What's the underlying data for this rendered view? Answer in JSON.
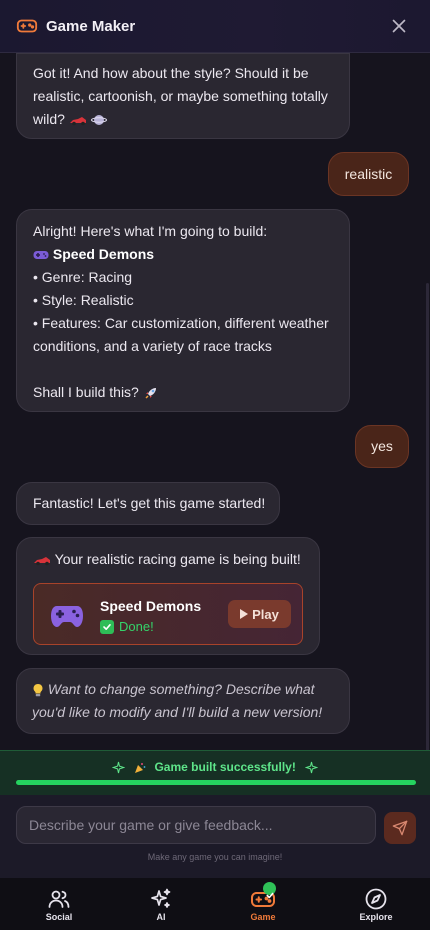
{
  "header": {
    "title": "Game Maker",
    "icon": "gamepad-icon",
    "close_icon": "close-icon"
  },
  "messages": {
    "m1": {
      "line1": "Got it! And how about the style? Should it be",
      "line2": "realistic, cartoonish, or maybe something totally",
      "line3": "wild? "
    },
    "m2": "realistic",
    "m3": {
      "intro": "Alright! Here's what I'm going to build:",
      "game_name": "Speed Demons",
      "genre": "• Genre: Racing",
      "style": "• Style: Realistic",
      "features_line1": "• Features: Car customization, different weather",
      "features_line2": "conditions, and a variety of race tracks",
      "question": "Shall I build this? "
    },
    "m4": "yes",
    "m5": "Fantastic! Let's get this game started!",
    "m6": {
      "text": "Your realistic racing game is being built!",
      "card_title": "Speed Demons",
      "card_status": "Done!",
      "play_label": "Play"
    },
    "m7": {
      "line1": "Want to change something? Describe what",
      "line2": "you'd like to modify and I'll build a new version!"
    }
  },
  "success": {
    "text": "Game built successfully!",
    "progress": 1.0
  },
  "input": {
    "placeholder": "Describe your game or give feedback...",
    "hint": "Make any game you can imagine!"
  },
  "nav": [
    {
      "label": "Social",
      "icon": "people-icon"
    },
    {
      "label": "AI",
      "icon": "sparkles-icon"
    },
    {
      "label": "Game",
      "icon": "gamepad-icon",
      "active": true
    },
    {
      "label": "Explore",
      "icon": "compass-icon"
    }
  ],
  "colors": {
    "accent": "#f07a3a",
    "success": "#25d35f",
    "user_bubble": "#4a2519",
    "bot_bubble": "#2a2731"
  }
}
